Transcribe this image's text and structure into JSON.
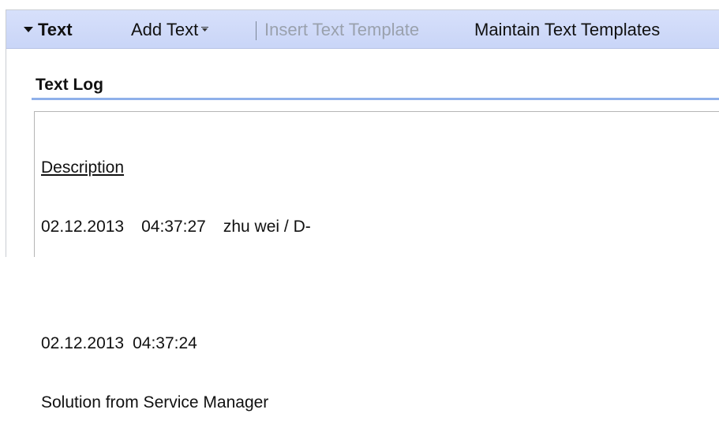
{
  "toolbar": {
    "title": "Text",
    "add_text": "Add Text",
    "insert_template": "Insert Text Template",
    "maintain_templates": "Maintain Text Templates"
  },
  "section": {
    "title": "Text Log"
  },
  "log": {
    "description_label": "Description",
    "entry1": {
      "date": "02.12.2013",
      "time": "04:37:27",
      "user": "zhu wei / D-"
    },
    "entry2": {
      "date": "02.12.2013",
      "time": "04:37:24",
      "text": "Solution from Service Manager"
    }
  },
  "icons": {
    "collapse": "triangle-down-icon",
    "dropdown": "chevron-down-icon"
  }
}
